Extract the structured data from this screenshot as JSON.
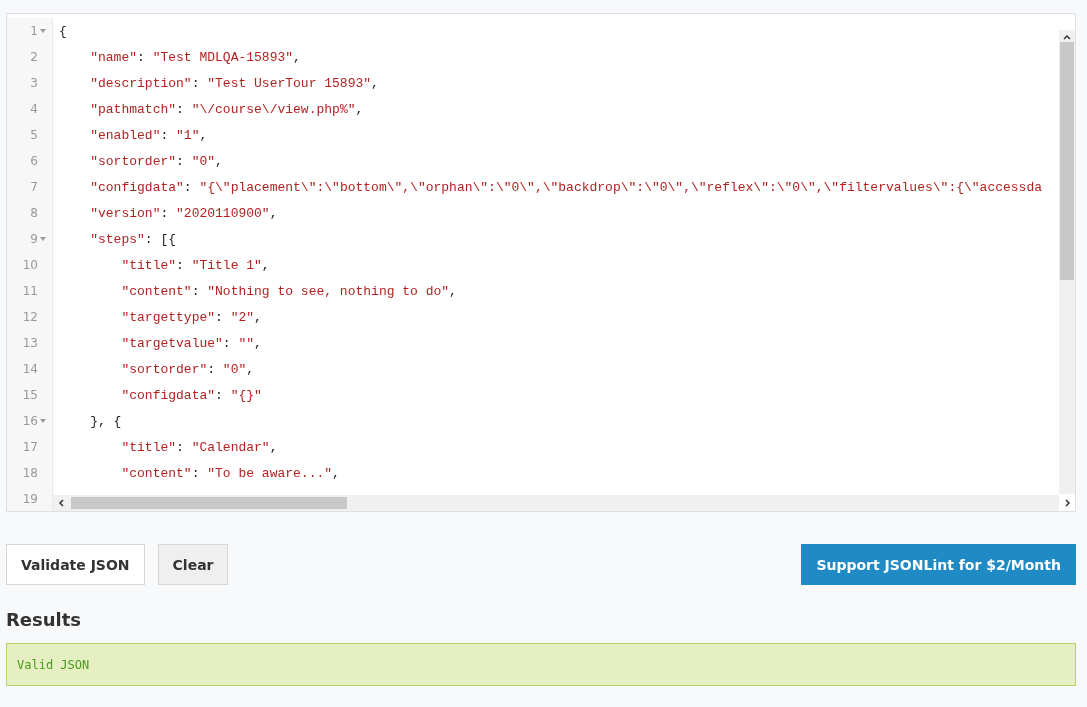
{
  "editor": {
    "lines": [
      {
        "number": "1",
        "foldable": true,
        "text": "{"
      },
      {
        "number": "2",
        "foldable": false,
        "text": "    \"name\": \"Test MDLQA-15893\","
      },
      {
        "number": "3",
        "foldable": false,
        "text": "    \"description\": \"Test UserTour 15893\","
      },
      {
        "number": "4",
        "foldable": false,
        "text": "    \"pathmatch\": \"\\/course\\/view.php%\","
      },
      {
        "number": "5",
        "foldable": false,
        "text": "    \"enabled\": \"1\","
      },
      {
        "number": "6",
        "foldable": false,
        "text": "    \"sortorder\": \"0\","
      },
      {
        "number": "7",
        "foldable": false,
        "text": "    \"configdata\": \"{\\\"placement\\\":\\\"bottom\\\",\\\"orphan\\\":\\\"0\\\",\\\"backdrop\\\":\\\"0\\\",\\\"reflex\\\":\\\"0\\\",\\\"filtervalues\\\":{\\\"accessda"
      },
      {
        "number": "8",
        "foldable": false,
        "text": "    \"version\": \"2020110900\","
      },
      {
        "number": "9",
        "foldable": true,
        "text": "    \"steps\": [{"
      },
      {
        "number": "10",
        "foldable": false,
        "text": "        \"title\": \"Title 1\","
      },
      {
        "number": "11",
        "foldable": false,
        "text": "        \"content\": \"Nothing to see, nothing to do\","
      },
      {
        "number": "12",
        "foldable": false,
        "text": "        \"targettype\": \"2\","
      },
      {
        "number": "13",
        "foldable": false,
        "text": "        \"targetvalue\": \"\","
      },
      {
        "number": "14",
        "foldable": false,
        "text": "        \"sortorder\": \"0\","
      },
      {
        "number": "15",
        "foldable": false,
        "text": "        \"configdata\": \"{}\""
      },
      {
        "number": "16",
        "foldable": true,
        "text": "    }, {"
      },
      {
        "number": "17",
        "foldable": false,
        "text": "        \"title\": \"Calendar\","
      },
      {
        "number": "18",
        "foldable": false,
        "text": "        \"content\": \"To be aware...\","
      },
      {
        "number": "19",
        "foldable": false
      }
    ]
  },
  "buttons": [
    {
      "label": "Validate JSON",
      "kind": "default"
    },
    {
      "label": "Clear",
      "kind": "secondary"
    }
  ],
  "support_button": {
    "label": "Support JSONLint for $2/Month"
  },
  "results": {
    "heading": "Results",
    "message": "Valid JSON"
  }
}
